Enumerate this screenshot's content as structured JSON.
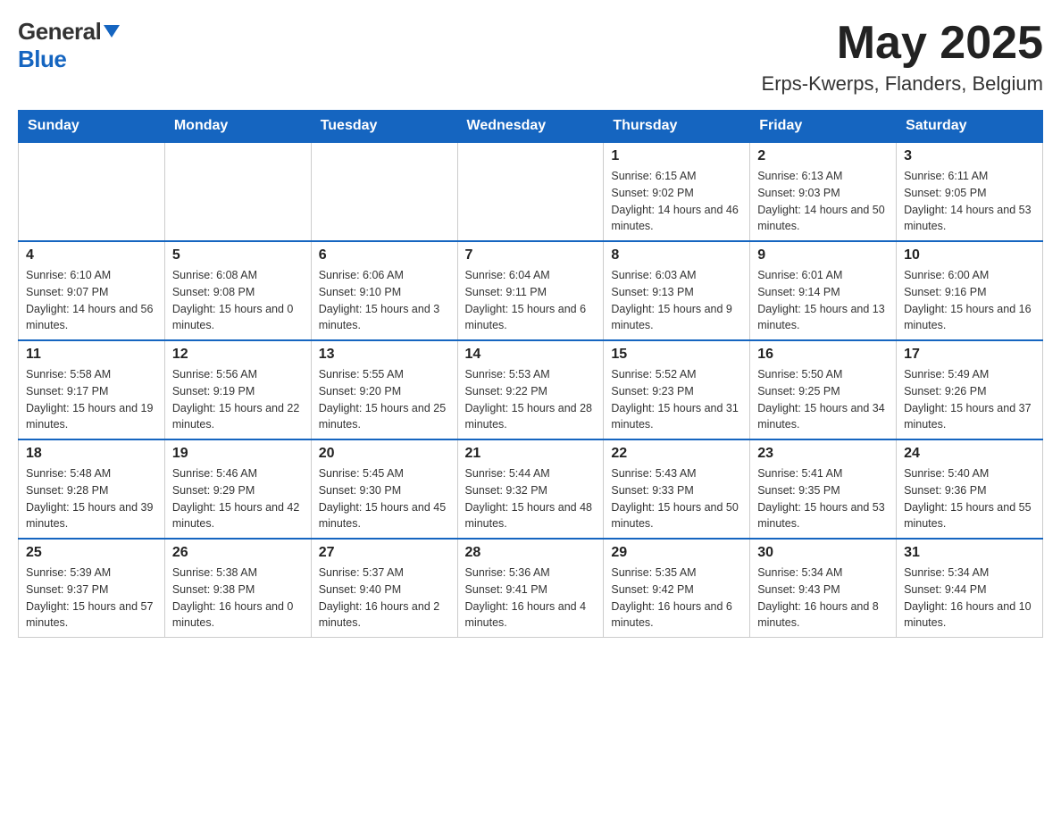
{
  "header": {
    "logo_general": "General",
    "logo_blue": "Blue",
    "month_year": "May 2025",
    "location": "Erps-Kwerps, Flanders, Belgium"
  },
  "days_of_week": [
    "Sunday",
    "Monday",
    "Tuesday",
    "Wednesday",
    "Thursday",
    "Friday",
    "Saturday"
  ],
  "weeks": [
    [
      {
        "day": "",
        "info": ""
      },
      {
        "day": "",
        "info": ""
      },
      {
        "day": "",
        "info": ""
      },
      {
        "day": "",
        "info": ""
      },
      {
        "day": "1",
        "info": "Sunrise: 6:15 AM\nSunset: 9:02 PM\nDaylight: 14 hours and 46 minutes."
      },
      {
        "day": "2",
        "info": "Sunrise: 6:13 AM\nSunset: 9:03 PM\nDaylight: 14 hours and 50 minutes."
      },
      {
        "day": "3",
        "info": "Sunrise: 6:11 AM\nSunset: 9:05 PM\nDaylight: 14 hours and 53 minutes."
      }
    ],
    [
      {
        "day": "4",
        "info": "Sunrise: 6:10 AM\nSunset: 9:07 PM\nDaylight: 14 hours and 56 minutes."
      },
      {
        "day": "5",
        "info": "Sunrise: 6:08 AM\nSunset: 9:08 PM\nDaylight: 15 hours and 0 minutes."
      },
      {
        "day": "6",
        "info": "Sunrise: 6:06 AM\nSunset: 9:10 PM\nDaylight: 15 hours and 3 minutes."
      },
      {
        "day": "7",
        "info": "Sunrise: 6:04 AM\nSunset: 9:11 PM\nDaylight: 15 hours and 6 minutes."
      },
      {
        "day": "8",
        "info": "Sunrise: 6:03 AM\nSunset: 9:13 PM\nDaylight: 15 hours and 9 minutes."
      },
      {
        "day": "9",
        "info": "Sunrise: 6:01 AM\nSunset: 9:14 PM\nDaylight: 15 hours and 13 minutes."
      },
      {
        "day": "10",
        "info": "Sunrise: 6:00 AM\nSunset: 9:16 PM\nDaylight: 15 hours and 16 minutes."
      }
    ],
    [
      {
        "day": "11",
        "info": "Sunrise: 5:58 AM\nSunset: 9:17 PM\nDaylight: 15 hours and 19 minutes."
      },
      {
        "day": "12",
        "info": "Sunrise: 5:56 AM\nSunset: 9:19 PM\nDaylight: 15 hours and 22 minutes."
      },
      {
        "day": "13",
        "info": "Sunrise: 5:55 AM\nSunset: 9:20 PM\nDaylight: 15 hours and 25 minutes."
      },
      {
        "day": "14",
        "info": "Sunrise: 5:53 AM\nSunset: 9:22 PM\nDaylight: 15 hours and 28 minutes."
      },
      {
        "day": "15",
        "info": "Sunrise: 5:52 AM\nSunset: 9:23 PM\nDaylight: 15 hours and 31 minutes."
      },
      {
        "day": "16",
        "info": "Sunrise: 5:50 AM\nSunset: 9:25 PM\nDaylight: 15 hours and 34 minutes."
      },
      {
        "day": "17",
        "info": "Sunrise: 5:49 AM\nSunset: 9:26 PM\nDaylight: 15 hours and 37 minutes."
      }
    ],
    [
      {
        "day": "18",
        "info": "Sunrise: 5:48 AM\nSunset: 9:28 PM\nDaylight: 15 hours and 39 minutes."
      },
      {
        "day": "19",
        "info": "Sunrise: 5:46 AM\nSunset: 9:29 PM\nDaylight: 15 hours and 42 minutes."
      },
      {
        "day": "20",
        "info": "Sunrise: 5:45 AM\nSunset: 9:30 PM\nDaylight: 15 hours and 45 minutes."
      },
      {
        "day": "21",
        "info": "Sunrise: 5:44 AM\nSunset: 9:32 PM\nDaylight: 15 hours and 48 minutes."
      },
      {
        "day": "22",
        "info": "Sunrise: 5:43 AM\nSunset: 9:33 PM\nDaylight: 15 hours and 50 minutes."
      },
      {
        "day": "23",
        "info": "Sunrise: 5:41 AM\nSunset: 9:35 PM\nDaylight: 15 hours and 53 minutes."
      },
      {
        "day": "24",
        "info": "Sunrise: 5:40 AM\nSunset: 9:36 PM\nDaylight: 15 hours and 55 minutes."
      }
    ],
    [
      {
        "day": "25",
        "info": "Sunrise: 5:39 AM\nSunset: 9:37 PM\nDaylight: 15 hours and 57 minutes."
      },
      {
        "day": "26",
        "info": "Sunrise: 5:38 AM\nSunset: 9:38 PM\nDaylight: 16 hours and 0 minutes."
      },
      {
        "day": "27",
        "info": "Sunrise: 5:37 AM\nSunset: 9:40 PM\nDaylight: 16 hours and 2 minutes."
      },
      {
        "day": "28",
        "info": "Sunrise: 5:36 AM\nSunset: 9:41 PM\nDaylight: 16 hours and 4 minutes."
      },
      {
        "day": "29",
        "info": "Sunrise: 5:35 AM\nSunset: 9:42 PM\nDaylight: 16 hours and 6 minutes."
      },
      {
        "day": "30",
        "info": "Sunrise: 5:34 AM\nSunset: 9:43 PM\nDaylight: 16 hours and 8 minutes."
      },
      {
        "day": "31",
        "info": "Sunrise: 5:34 AM\nSunset: 9:44 PM\nDaylight: 16 hours and 10 minutes."
      }
    ]
  ]
}
